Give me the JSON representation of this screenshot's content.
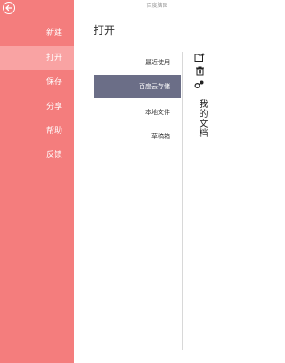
{
  "app": {
    "title": "百度脑图"
  },
  "sidebar": {
    "back_icon": "back-arrow-icon",
    "items": [
      {
        "label": "新建"
      },
      {
        "label": "打开"
      },
      {
        "label": "保存"
      },
      {
        "label": "分享"
      },
      {
        "label": "帮助"
      },
      {
        "label": "反馈"
      }
    ],
    "active_index": 1
  },
  "open_panel": {
    "title": "打开",
    "items": [
      {
        "label": "最近使用"
      },
      {
        "label": "百度云存储"
      },
      {
        "label": "本地文件"
      },
      {
        "label": "草稿箱"
      }
    ],
    "active_index": 1
  },
  "cloud_panel": {
    "icons": [
      "new-folder-icon",
      "delete-icon",
      "share-icon"
    ],
    "folder_label": "我的文档"
  },
  "colors": {
    "sidebar_bg": "#f47d7d",
    "sidebar_active_bg": "#f9a3a3",
    "list_active_bg": "#6b6e87"
  }
}
